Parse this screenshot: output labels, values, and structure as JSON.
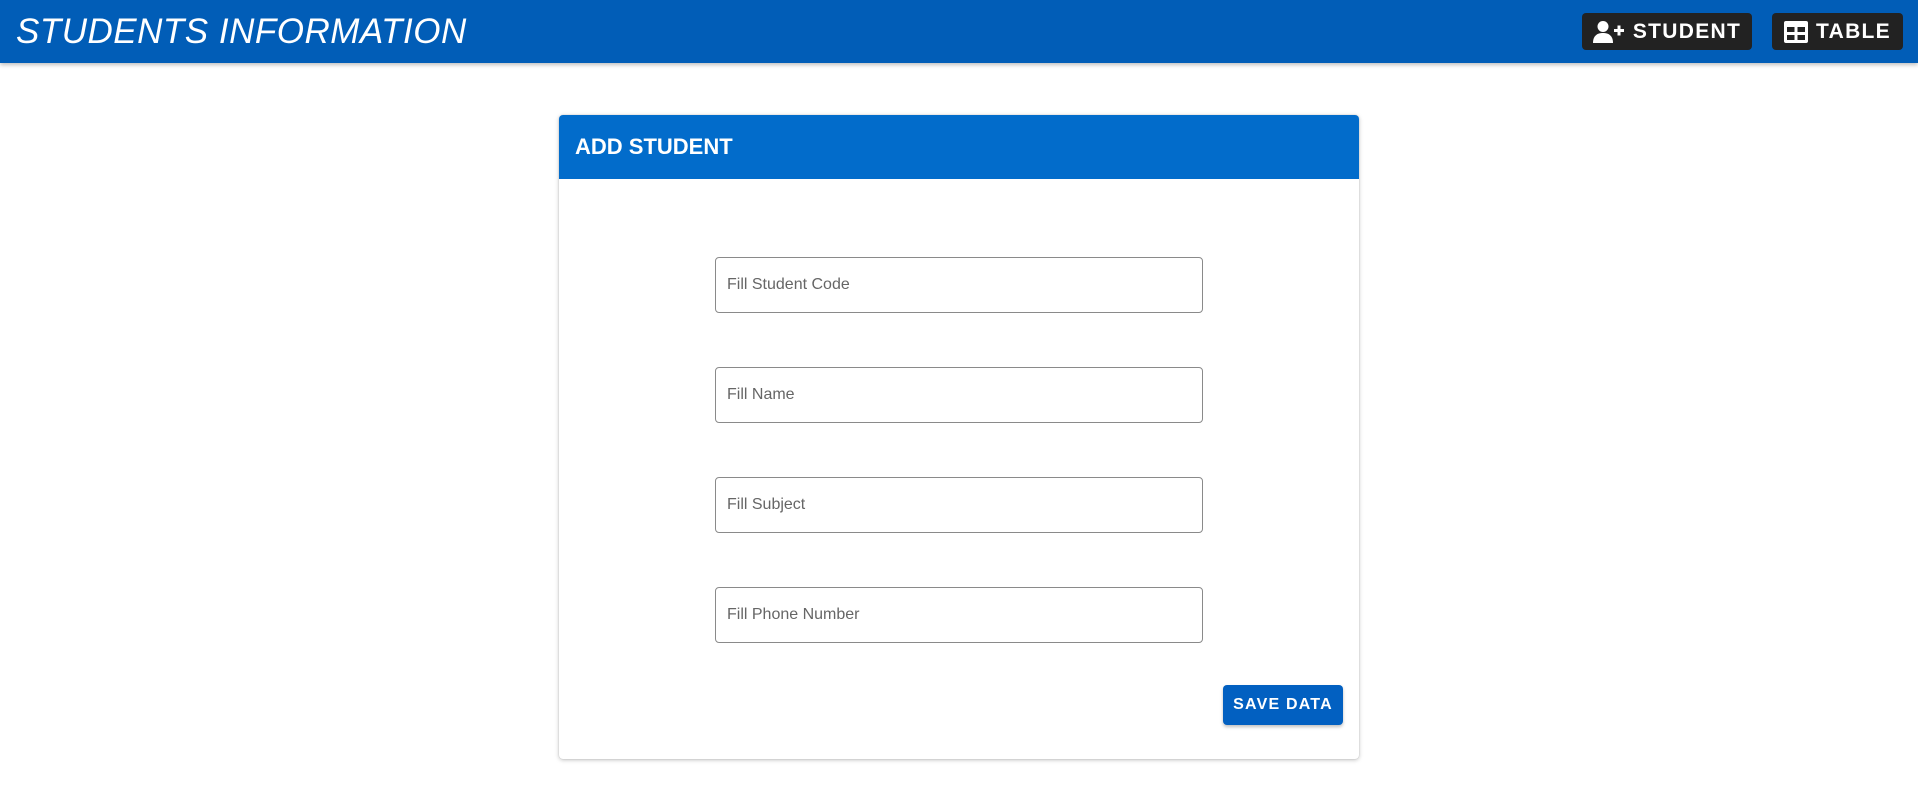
{
  "header": {
    "title": "STUDENTS INFORMATION",
    "buttons": [
      {
        "label": "STUDENT",
        "icon": "person-add-icon"
      },
      {
        "label": "TABLE",
        "icon": "table-icon"
      }
    ]
  },
  "form": {
    "title": "ADD STUDENT",
    "fields": [
      {
        "placeholder": "Fill Student Code",
        "value": ""
      },
      {
        "placeholder": "Fill Name",
        "value": ""
      },
      {
        "placeholder": "Fill Subject",
        "value": ""
      },
      {
        "placeholder": "Fill Phone Number",
        "value": ""
      }
    ],
    "save_label": "SAVE DATA"
  },
  "colors": {
    "app_bar": "#015db7",
    "card_header": "#026ccb",
    "nav_button": "#222222",
    "save_button": "#0260c1"
  }
}
